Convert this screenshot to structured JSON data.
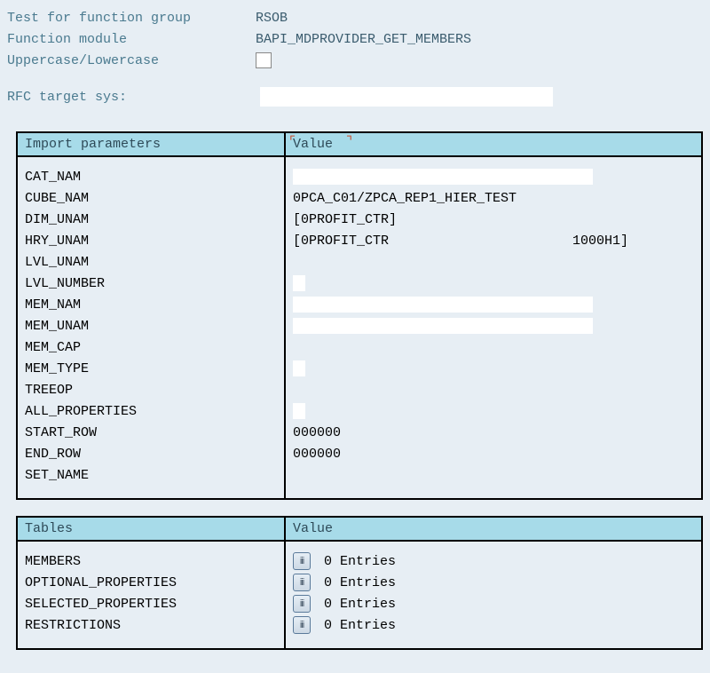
{
  "top": {
    "test_label": "Test for function group",
    "test_value": "RSOB",
    "fm_label": "Function module",
    "fm_value": "BAPI_MDPROVIDER_GET_MEMBERS",
    "case_label": "Uppercase/Lowercase",
    "rfc_label": "RFC target sys:"
  },
  "import_header": {
    "param_col": "Import parameters",
    "value_col": "Value"
  },
  "import_params": [
    {
      "name": "CAT_NAM",
      "value": "",
      "kind": "wide"
    },
    {
      "name": "CUBE_NAM",
      "value": "0PCA_C01/ZPCA_REP1_HIER_TEST",
      "kind": "text"
    },
    {
      "name": "DIM_UNAM",
      "value": "[0PROFIT_CTR]",
      "kind": "text"
    },
    {
      "name": "HRY_UNAM",
      "value": "[0PROFIT_CTR                       1000H1]",
      "kind": "text"
    },
    {
      "name": "LVL_UNAM",
      "value": "",
      "kind": "none"
    },
    {
      "name": "LVL_NUMBER",
      "value": "",
      "kind": "small"
    },
    {
      "name": "MEM_NAM",
      "value": "",
      "kind": "wide"
    },
    {
      "name": "MEM_UNAM",
      "value": "",
      "kind": "wide"
    },
    {
      "name": "MEM_CAP",
      "value": "",
      "kind": "none"
    },
    {
      "name": "MEM_TYPE",
      "value": "",
      "kind": "small"
    },
    {
      "name": "TREEOP",
      "value": "",
      "kind": "none"
    },
    {
      "name": "ALL_PROPERTIES",
      "value": "",
      "kind": "small"
    },
    {
      "name": "START_ROW",
      "value": "000000",
      "kind": "text"
    },
    {
      "name": "END_ROW",
      "value": "000000",
      "kind": "text"
    },
    {
      "name": "SET_NAME",
      "value": "",
      "kind": "none"
    }
  ],
  "tables_header": {
    "param_col": "Tables",
    "value_col": "Value"
  },
  "tables": [
    {
      "name": "MEMBERS",
      "entries": "0 Entries"
    },
    {
      "name": "OPTIONAL_PROPERTIES",
      "entries": "0 Entries"
    },
    {
      "name": "SELECTED_PROPERTIES",
      "entries": "0 Entries"
    },
    {
      "name": "RESTRICTIONS",
      "entries": "0 Entries"
    }
  ]
}
